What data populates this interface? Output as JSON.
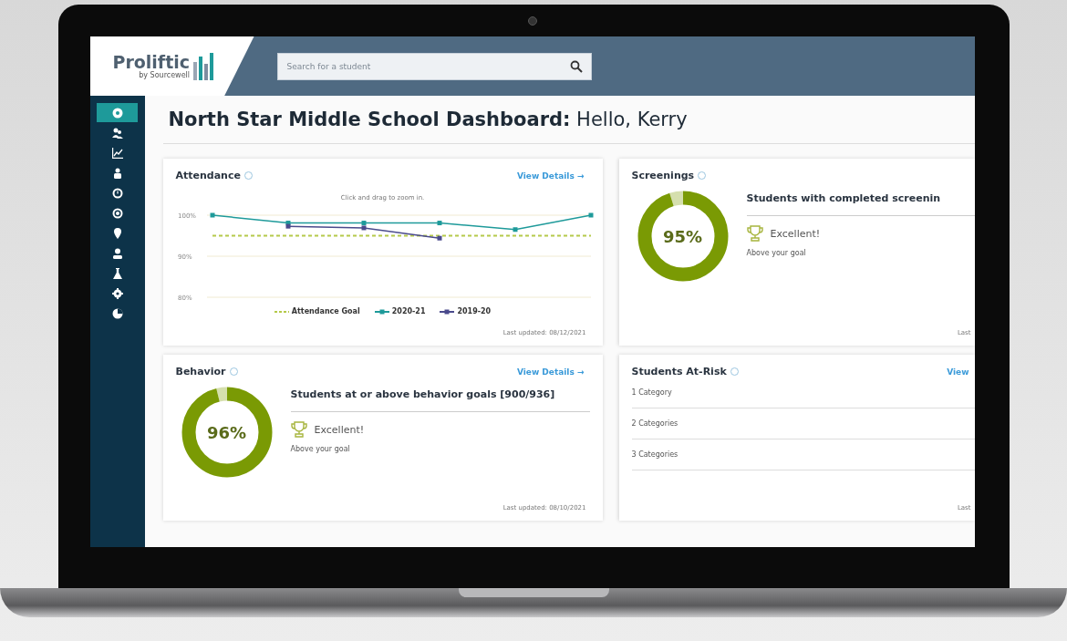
{
  "header": {
    "logo": "Proliftic",
    "logo_sub": "by Sourcewell",
    "search": {
      "placeholder": "Search for a student"
    }
  },
  "sidebar": {
    "items": [
      {
        "selected": true
      },
      {
        "selected": false
      },
      {
        "selected": false
      },
      {
        "selected": false
      },
      {
        "selected": false
      },
      {
        "selected": false
      },
      {
        "selected": false
      },
      {
        "selected": false
      },
      {
        "selected": false
      },
      {
        "selected": false
      },
      {
        "selected": false
      }
    ]
  },
  "page_title": {
    "bold": "North Star Middle School Dashboard:",
    "greeting": "Hello, Kerry"
  },
  "attendance": {
    "title": "Attendance",
    "link": "View Details →",
    "hint": "Click and drag to zoom in.",
    "updated": "Last updated: 08/12/2021",
    "chart_data": {
      "type": "line",
      "ylim": [
        80,
        100
      ],
      "yticks": [
        {
          "value": 80,
          "label": "80%"
        },
        {
          "value": 90,
          "label": "90%"
        },
        {
          "value": 100,
          "label": "100%"
        }
      ],
      "series": [
        {
          "name": "Attendance Goal",
          "color": "#b5c94a",
          "line_style": "dashed",
          "values": [
            95,
            95,
            95,
            95,
            95,
            95
          ]
        },
        {
          "name": "2020-21",
          "color": "#1e9a9a",
          "marker": "square",
          "values": [
            100,
            98.1,
            98.1,
            98.1,
            96.5,
            100
          ]
        },
        {
          "name": "2019-20",
          "color": "#4a4a8c",
          "marker": "square",
          "values": [
            null,
            97.3,
            96.9,
            94.4,
            null,
            null
          ]
        }
      ]
    }
  },
  "screenings": {
    "title": "Screenings",
    "percent": "95%",
    "level": 0.95,
    "heading": "Students with completed screenin",
    "rating": "Excellent!",
    "note": "Above your goal",
    "updated": "Last"
  },
  "behavior": {
    "title": "Behavior",
    "link": "View Details →",
    "percent": "96%",
    "level": 0.96,
    "heading": "Students at or above behavior goals [900/936]",
    "rating": "Excellent!",
    "note": "Above your goal",
    "updated": "Last updated: 08/10/2021"
  },
  "at_risk": {
    "title": "Students At-Risk",
    "link": "View",
    "rows": [
      "1 Category",
      "2 Categories",
      "3 Categories"
    ],
    "updated": "Last"
  }
}
